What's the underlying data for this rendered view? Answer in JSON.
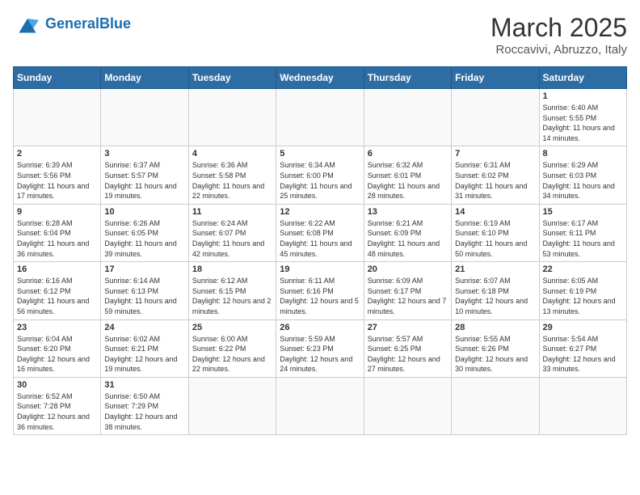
{
  "header": {
    "logo_general": "General",
    "logo_blue": "Blue",
    "month_year": "March 2025",
    "location": "Roccavivi, Abruzzo, Italy"
  },
  "weekdays": [
    "Sunday",
    "Monday",
    "Tuesday",
    "Wednesday",
    "Thursday",
    "Friday",
    "Saturday"
  ],
  "weeks": [
    [
      {
        "day": "",
        "info": ""
      },
      {
        "day": "",
        "info": ""
      },
      {
        "day": "",
        "info": ""
      },
      {
        "day": "",
        "info": ""
      },
      {
        "day": "",
        "info": ""
      },
      {
        "day": "",
        "info": ""
      },
      {
        "day": "1",
        "info": "Sunrise: 6:40 AM\nSunset: 5:55 PM\nDaylight: 11 hours\nand 14 minutes."
      }
    ],
    [
      {
        "day": "2",
        "info": "Sunrise: 6:39 AM\nSunset: 5:56 PM\nDaylight: 11 hours\nand 17 minutes."
      },
      {
        "day": "3",
        "info": "Sunrise: 6:37 AM\nSunset: 5:57 PM\nDaylight: 11 hours\nand 19 minutes."
      },
      {
        "day": "4",
        "info": "Sunrise: 6:36 AM\nSunset: 5:58 PM\nDaylight: 11 hours\nand 22 minutes."
      },
      {
        "day": "5",
        "info": "Sunrise: 6:34 AM\nSunset: 6:00 PM\nDaylight: 11 hours\nand 25 minutes."
      },
      {
        "day": "6",
        "info": "Sunrise: 6:32 AM\nSunset: 6:01 PM\nDaylight: 11 hours\nand 28 minutes."
      },
      {
        "day": "7",
        "info": "Sunrise: 6:31 AM\nSunset: 6:02 PM\nDaylight: 11 hours\nand 31 minutes."
      },
      {
        "day": "8",
        "info": "Sunrise: 6:29 AM\nSunset: 6:03 PM\nDaylight: 11 hours\nand 34 minutes."
      }
    ],
    [
      {
        "day": "9",
        "info": "Sunrise: 6:28 AM\nSunset: 6:04 PM\nDaylight: 11 hours\nand 36 minutes."
      },
      {
        "day": "10",
        "info": "Sunrise: 6:26 AM\nSunset: 6:05 PM\nDaylight: 11 hours\nand 39 minutes."
      },
      {
        "day": "11",
        "info": "Sunrise: 6:24 AM\nSunset: 6:07 PM\nDaylight: 11 hours\nand 42 minutes."
      },
      {
        "day": "12",
        "info": "Sunrise: 6:22 AM\nSunset: 6:08 PM\nDaylight: 11 hours\nand 45 minutes."
      },
      {
        "day": "13",
        "info": "Sunrise: 6:21 AM\nSunset: 6:09 PM\nDaylight: 11 hours\nand 48 minutes."
      },
      {
        "day": "14",
        "info": "Sunrise: 6:19 AM\nSunset: 6:10 PM\nDaylight: 11 hours\nand 50 minutes."
      },
      {
        "day": "15",
        "info": "Sunrise: 6:17 AM\nSunset: 6:11 PM\nDaylight: 11 hours\nand 53 minutes."
      }
    ],
    [
      {
        "day": "16",
        "info": "Sunrise: 6:16 AM\nSunset: 6:12 PM\nDaylight: 11 hours\nand 56 minutes."
      },
      {
        "day": "17",
        "info": "Sunrise: 6:14 AM\nSunset: 6:13 PM\nDaylight: 11 hours\nand 59 minutes."
      },
      {
        "day": "18",
        "info": "Sunrise: 6:12 AM\nSunset: 6:15 PM\nDaylight: 12 hours\nand 2 minutes."
      },
      {
        "day": "19",
        "info": "Sunrise: 6:11 AM\nSunset: 6:16 PM\nDaylight: 12 hours\nand 5 minutes."
      },
      {
        "day": "20",
        "info": "Sunrise: 6:09 AM\nSunset: 6:17 PM\nDaylight: 12 hours\nand 7 minutes."
      },
      {
        "day": "21",
        "info": "Sunrise: 6:07 AM\nSunset: 6:18 PM\nDaylight: 12 hours\nand 10 minutes."
      },
      {
        "day": "22",
        "info": "Sunrise: 6:05 AM\nSunset: 6:19 PM\nDaylight: 12 hours\nand 13 minutes."
      }
    ],
    [
      {
        "day": "23",
        "info": "Sunrise: 6:04 AM\nSunset: 6:20 PM\nDaylight: 12 hours\nand 16 minutes."
      },
      {
        "day": "24",
        "info": "Sunrise: 6:02 AM\nSunset: 6:21 PM\nDaylight: 12 hours\nand 19 minutes."
      },
      {
        "day": "25",
        "info": "Sunrise: 6:00 AM\nSunset: 6:22 PM\nDaylight: 12 hours\nand 22 minutes."
      },
      {
        "day": "26",
        "info": "Sunrise: 5:59 AM\nSunset: 6:23 PM\nDaylight: 12 hours\nand 24 minutes."
      },
      {
        "day": "27",
        "info": "Sunrise: 5:57 AM\nSunset: 6:25 PM\nDaylight: 12 hours\nand 27 minutes."
      },
      {
        "day": "28",
        "info": "Sunrise: 5:55 AM\nSunset: 6:26 PM\nDaylight: 12 hours\nand 30 minutes."
      },
      {
        "day": "29",
        "info": "Sunrise: 5:54 AM\nSunset: 6:27 PM\nDaylight: 12 hours\nand 33 minutes."
      }
    ],
    [
      {
        "day": "30",
        "info": "Sunrise: 6:52 AM\nSunset: 7:28 PM\nDaylight: 12 hours\nand 36 minutes."
      },
      {
        "day": "31",
        "info": "Sunrise: 6:50 AM\nSunset: 7:29 PM\nDaylight: 12 hours\nand 38 minutes."
      },
      {
        "day": "",
        "info": ""
      },
      {
        "day": "",
        "info": ""
      },
      {
        "day": "",
        "info": ""
      },
      {
        "day": "",
        "info": ""
      },
      {
        "day": "",
        "info": ""
      }
    ]
  ]
}
